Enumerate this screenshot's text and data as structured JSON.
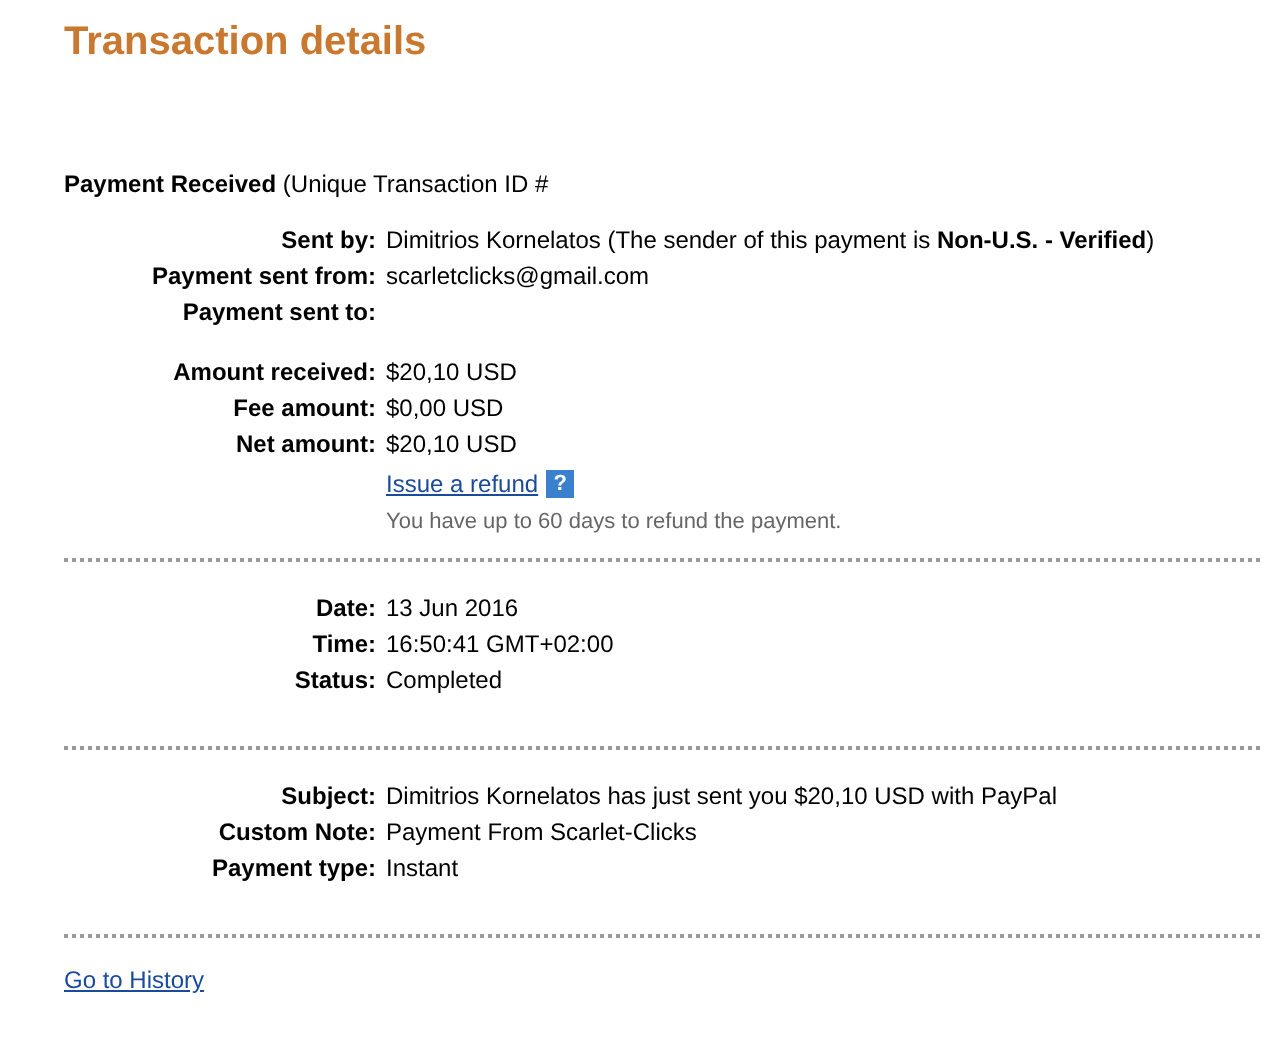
{
  "title": "Transaction details",
  "header": {
    "label": "Payment Received",
    "text": "(Unique Transaction ID #"
  },
  "sections": [
    {
      "groups": [
        [
          {
            "label": "Sent by:",
            "value": "Dimitrios Kornelatos (The sender of this payment is **Non-U.S. - Verified**)"
          },
          {
            "label": "Payment sent from:",
            "value": "scarletclicks@gmail.com"
          },
          {
            "label": "Payment sent to:"
          }
        ],
        [
          {
            "label": "Amount received:",
            "value": "$20,10 USD"
          },
          {
            "label": "Fee amount:",
            "value": "$0,00 USD"
          },
          {
            "label": "Net amount:",
            "value": "$20,10 USD"
          }
        ]
      ],
      "refund": {
        "link": "Issue a refund",
        "help": "?",
        "note": "You have up to 60 days to refund the payment."
      }
    },
    {
      "groups": [
        [
          {
            "label": "Date:",
            "value": "13 Jun 2016"
          },
          {
            "label": "Time:",
            "value": "16:50:41 GMT+02:00"
          },
          {
            "label": "Status:",
            "value": "Completed"
          }
        ]
      ]
    },
    {
      "groups": [
        [
          {
            "label": "Subject:",
            "value": "Dimitrios Kornelatos has just sent you $20,10 USD with PayPal"
          },
          {
            "label": "Custom Note:",
            "value": "Payment From Scarlet-Clicks"
          },
          {
            "label": "Payment type:",
            "value": "Instant"
          }
        ]
      ]
    }
  ],
  "history_link": "Go to History"
}
